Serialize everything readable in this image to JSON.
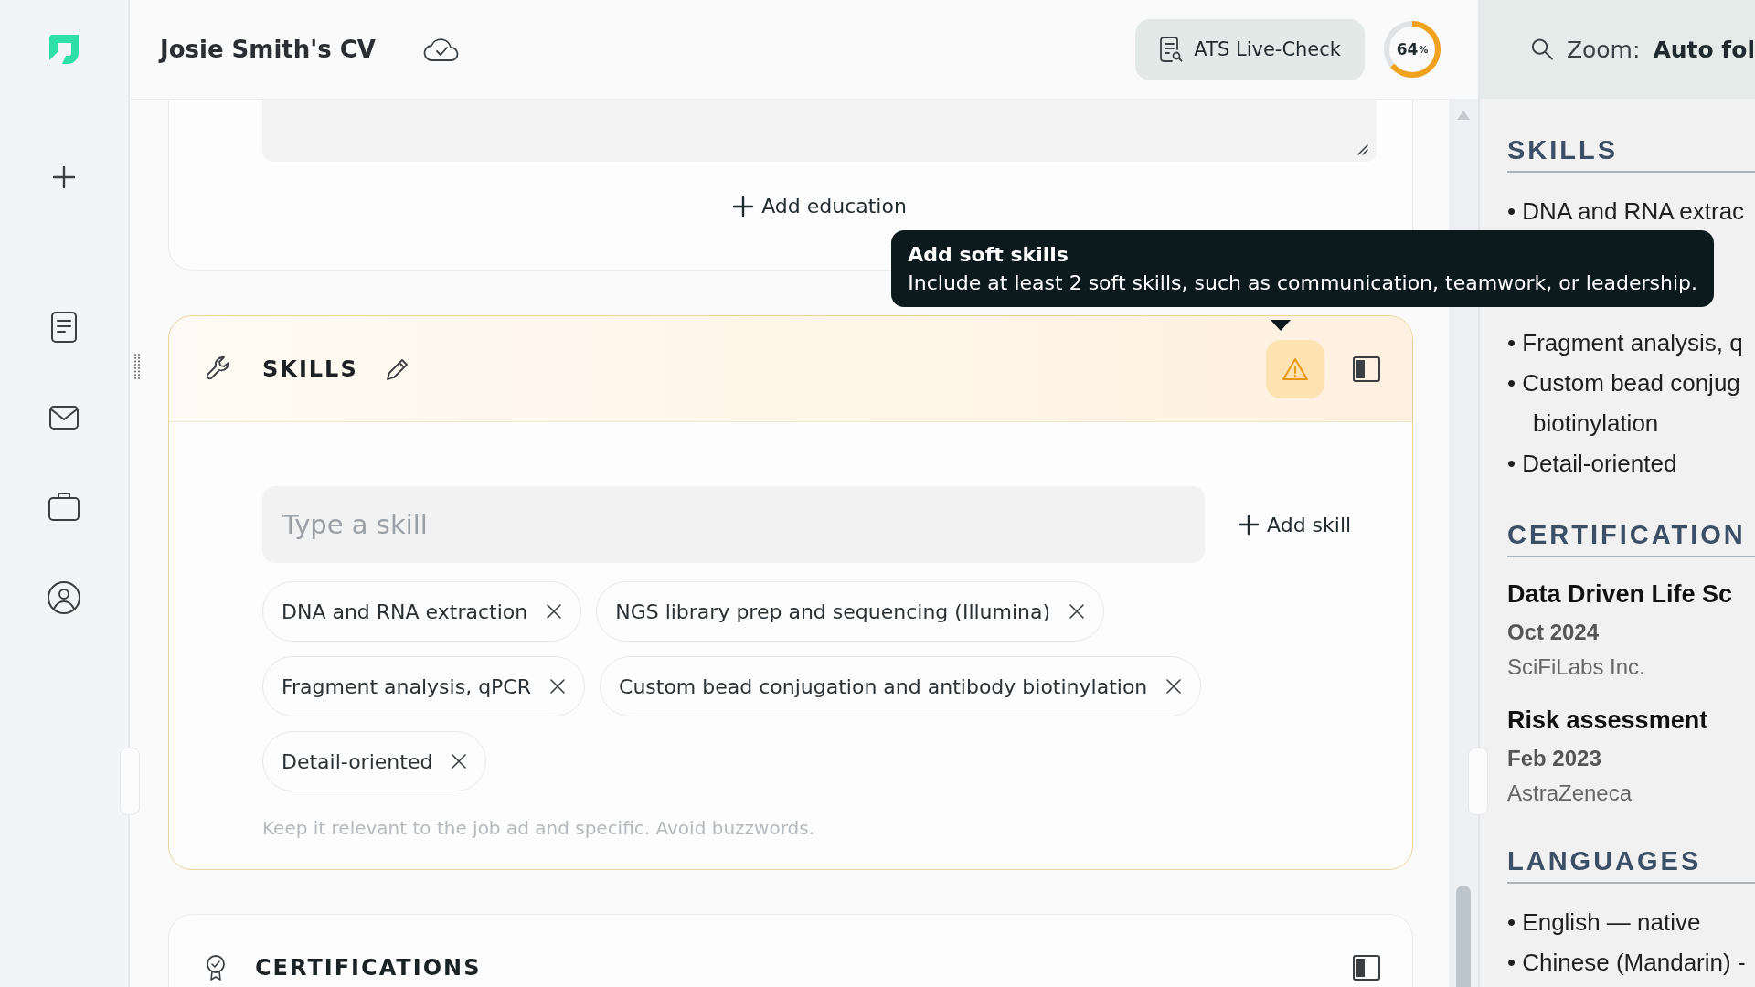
{
  "header": {
    "title": "Josie Smith's CV",
    "ats_button": "ATS Live-Check",
    "score": "64",
    "score_unit": "%",
    "score_ring": {
      "level": 0.64
    }
  },
  "preview_toolbar": {
    "zoom_label": "Zoom:",
    "zoom_value": "Auto fol"
  },
  "education": {
    "add_button": "Add education"
  },
  "skills": {
    "title": "SKILLS",
    "warning": true,
    "placeholder": "Type a skill",
    "add_button": "Add skill",
    "chips": [
      {
        "label": "DNA and RNA extraction"
      },
      {
        "label": "NGS library prep and sequencing (Illumina)"
      },
      {
        "label": "Fragment analysis, qPCR"
      },
      {
        "label": "Custom bead conjugation and antibody biotinylation"
      },
      {
        "label": "Detail-oriented"
      }
    ],
    "hint": "Keep it relevant to the job ad and specific. Avoid buzzwords."
  },
  "certifications": {
    "title": "CERTIFICATIONS"
  },
  "tooltip": {
    "title": "Add soft skills",
    "text": "Include at least 2 soft skills, such as communication, teamwork, or leadership."
  },
  "preview": {
    "sections": [
      {
        "kind": "list",
        "heading": "SKILLS",
        "items": [
          {
            "lines": [
              "• DNA and RNA extrac"
            ]
          },
          {
            "lines": [
              "• Fragment analysis, q"
            ]
          },
          {
            "lines": [
              "• Custom bead conjug",
              "biotinylation"
            ]
          },
          {
            "lines": [
              "• Detail-oriented"
            ]
          }
        ]
      },
      {
        "kind": "entries",
        "heading": "CERTIFICATION",
        "entries": [
          {
            "title": "Data Driven Life Sc",
            "date": "Oct 2024",
            "issuer": "SciFiLabs Inc."
          },
          {
            "title": "Risk assessment",
            "date": "Feb 2023",
            "issuer": "AstraZeneca"
          }
        ]
      },
      {
        "kind": "list",
        "heading": "LANGUAGES",
        "items": [
          {
            "lines": [
              "• English — native"
            ]
          },
          {
            "lines": [
              "• Chinese (Mandarin) -"
            ]
          }
        ]
      }
    ]
  }
}
